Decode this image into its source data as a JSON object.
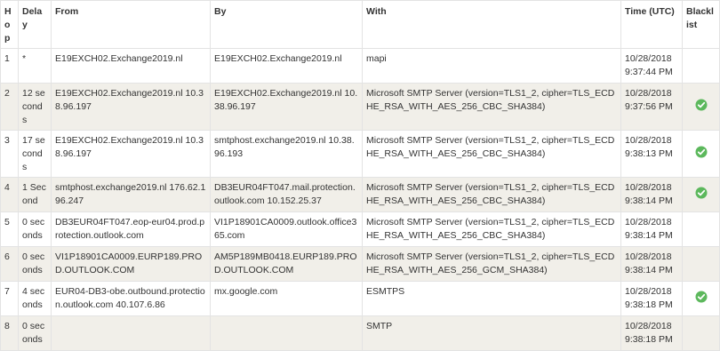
{
  "headers": {
    "hop": "Hop",
    "delay": "Delay",
    "from": "From",
    "by": "By",
    "with": "With",
    "time": "Time (UTC)",
    "blacklist": "Blacklist"
  },
  "rows": [
    {
      "hop": "1",
      "delay": "*",
      "from": "E19EXCH02.Exchange2019.nl",
      "by": "E19EXCH02.Exchange2019.nl",
      "with": "mapi",
      "time": "10/28/2018 9:37:44 PM",
      "blacklist_ok": false
    },
    {
      "hop": "2",
      "delay": "12 seconds",
      "from": "E19EXCH02.Exchange2019.nl 10.38.96.197",
      "by": "E19EXCH02.Exchange2019.nl 10.38.96.197",
      "with": "Microsoft SMTP Server (version=TLS1_2, cipher=TLS_ECDHE_RSA_WITH_AES_256_CBC_SHA384)",
      "time": "10/28/2018 9:37:56 PM",
      "blacklist_ok": true
    },
    {
      "hop": "3",
      "delay": "17 seconds",
      "from": "E19EXCH02.Exchange2019.nl 10.38.96.197",
      "by": "smtphost.exchange2019.nl 10.38.96.193",
      "with": "Microsoft SMTP Server (version=TLS1_2, cipher=TLS_ECDHE_RSA_WITH_AES_256_CBC_SHA384)",
      "time": "10/28/2018 9:38:13 PM",
      "blacklist_ok": true
    },
    {
      "hop": "4",
      "delay": "1 Second",
      "from": "smtphost.exchange2019.nl 176.62.196.247",
      "by": "DB3EUR04FT047.mail.protection.outlook.com 10.152.25.37",
      "with": "Microsoft SMTP Server (version=TLS1_2, cipher=TLS_ECDHE_RSA_WITH_AES_256_CBC_SHA384)",
      "time": "10/28/2018 9:38:14 PM",
      "blacklist_ok": true
    },
    {
      "hop": "5",
      "delay": "0 seconds",
      "from": "DB3EUR04FT047.eop-eur04.prod.protection.outlook.com",
      "by": "VI1P18901CA0009.outlook.office365.com",
      "with": "Microsoft SMTP Server (version=TLS1_2, cipher=TLS_ECDHE_RSA_WITH_AES_256_CBC_SHA384)",
      "time": "10/28/2018 9:38:14 PM",
      "blacklist_ok": false
    },
    {
      "hop": "6",
      "delay": "0 seconds",
      "from": "VI1P18901CA0009.EURP189.PROD.OUTLOOK.COM",
      "by": "AM5P189MB0418.EURP189.PROD.OUTLOOK.COM",
      "with": "Microsoft SMTP Server (version=TLS1_2, cipher=TLS_ECDHE_RSA_WITH_AES_256_GCM_SHA384)",
      "time": "10/28/2018 9:38:14 PM",
      "blacklist_ok": false
    },
    {
      "hop": "7",
      "delay": "4 seconds",
      "from": "EUR04-DB3-obe.outbound.protection.outlook.com 40.107.6.86",
      "by": "mx.google.com",
      "with": "ESMTPS",
      "time": "10/28/2018 9:38:18 PM",
      "blacklist_ok": true
    },
    {
      "hop": "8",
      "delay": "0 seconds",
      "from": "",
      "by": "",
      "with": "SMTP",
      "time": "10/28/2018 9:38:18 PM",
      "blacklist_ok": false
    }
  ],
  "colors": {
    "check": "#5cb85c",
    "row_alt": "#f1efe9",
    "border": "#e3e3e3"
  },
  "icons": {
    "blacklist_ok": "check-circle-icon"
  }
}
